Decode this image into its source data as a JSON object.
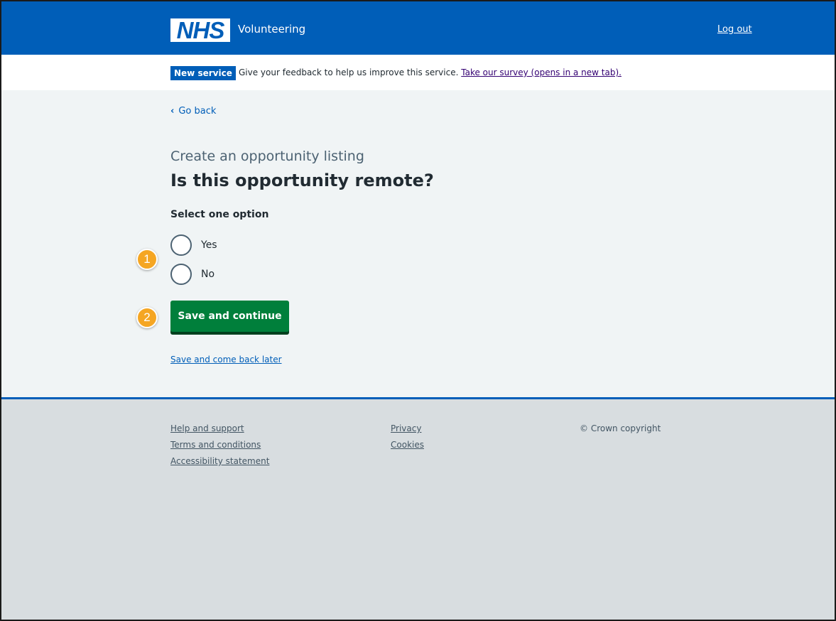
{
  "header": {
    "logo_text": "NHS",
    "service_name": "Volunteering",
    "logout_label": "Log out"
  },
  "banner": {
    "tag": "New service",
    "text": "Give your feedback to help us improve this service.",
    "link": "Take our survey (opens in a new tab)."
  },
  "main": {
    "back_label": "Go back",
    "caption": "Create an opportunity listing",
    "heading": "Is this opportunity remote?",
    "legend": "Select one option",
    "options": [
      {
        "label": "Yes"
      },
      {
        "label": "No"
      }
    ],
    "submit_label": "Save and continue",
    "later_label": "Save and come back later"
  },
  "markers": [
    "1",
    "2"
  ],
  "footer": {
    "col1": [
      "Help and support",
      "Terms and conditions",
      "Accessibility statement"
    ],
    "col2": [
      "Privacy",
      "Cookies"
    ],
    "copyright": "© Crown copyright"
  },
  "colors": {
    "nhs_blue": "#005eb8",
    "button_green": "#007f3b",
    "marker_orange": "#f5a623",
    "page_background": "#f0f4f5",
    "footer_background": "#d8dde0"
  }
}
